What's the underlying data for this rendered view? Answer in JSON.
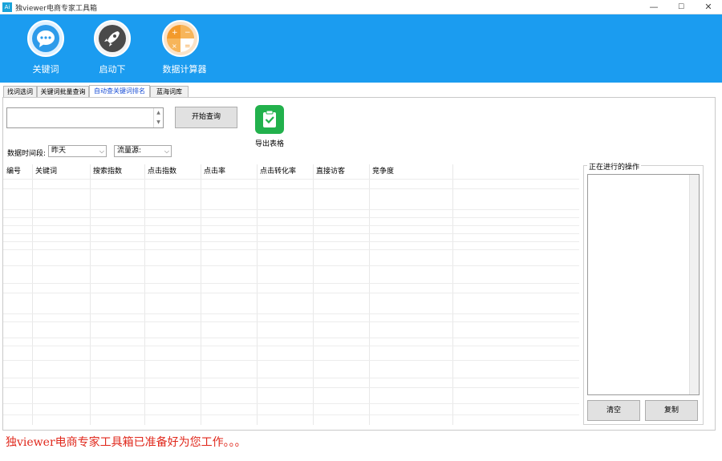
{
  "window": {
    "title": "独viewer电商专家工具箱",
    "minimize": "—",
    "maximize": "☐",
    "close": "✕",
    "icon_label": "Ai"
  },
  "header": {
    "buttons": [
      {
        "label": "关键词",
        "icon": "chat-bubble-icon"
      },
      {
        "label": "启动下",
        "icon": "rocket-icon"
      },
      {
        "label": "数据计算器",
        "icon": "calculator-icon"
      }
    ]
  },
  "tabs": [
    {
      "label": "找词选词"
    },
    {
      "label": "关键词批量查询"
    },
    {
      "label": "自动查关键词排名"
    },
    {
      "label": "蓝海词库"
    }
  ],
  "query": {
    "value": "",
    "start_button": "开始查询",
    "export_label": "导出表格"
  },
  "filters": {
    "period_label": "数据时间段:",
    "period_value": "昨天",
    "terminal_label": "流量源:",
    "terminal_value": ""
  },
  "table": {
    "columns": [
      "编号",
      "关键词",
      "搜索指数",
      "点击指数",
      "点击率",
      "点击转化率",
      "直接访客",
      "竞争度"
    ]
  },
  "side_panel": {
    "title": "正在进行的操作",
    "log_text": "",
    "clear_button": "清空",
    "copy_button": "复制"
  },
  "status": {
    "text": "独viewer电商专家工具箱已准备好为您工作。。。"
  },
  "colors": {
    "header_blue": "#1b9cf0",
    "status_red": "#e0281c",
    "active_tab_text": "#1a4fd6",
    "export_green": "#22b14c"
  }
}
